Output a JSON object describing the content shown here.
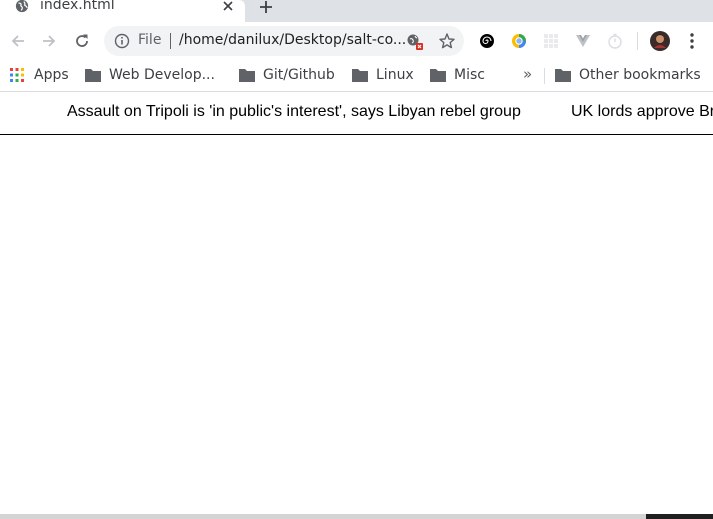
{
  "tab": {
    "title": "index.html",
    "favicon": "globe-icon"
  },
  "toolbar": {
    "back_icon": "back-arrow-icon",
    "forward_icon": "forward-arrow-icon",
    "reload_icon": "reload-icon",
    "omnibox": {
      "scheme_label": "File",
      "url": "/home/danilux/Desktop/salt-co...",
      "info_icon": "info-icon",
      "bookmark_icon": "star-icon"
    },
    "menu_icon": "kebab-menu-icon"
  },
  "bookmarks": {
    "items": [
      {
        "label": "Apps",
        "icon": "apps-grid-icon"
      },
      {
        "label": "Web Develop...",
        "icon": "folder-icon"
      },
      {
        "label": "Git/Github",
        "icon": "folder-icon"
      },
      {
        "label": "Linux",
        "icon": "folder-icon"
      },
      {
        "label": "Misc",
        "icon": "folder-icon"
      }
    ],
    "overflow_label": "»",
    "other": {
      "label": "Other bookmarks",
      "icon": "folder-icon"
    }
  },
  "ticker": {
    "headlines": [
      "Assault on Tripoli is 'in public's interest', says Libyan rebel group",
      "UK lords approve Br"
    ]
  },
  "colors": {
    "tabstrip": "#dee1e6",
    "omnibox": "#f1f3f4",
    "folder": "#5f6368",
    "apps_red": "#ea4335",
    "apps_green": "#34a853",
    "apps_blue": "#4285f4",
    "apps_yellow": "#fbbc04"
  }
}
